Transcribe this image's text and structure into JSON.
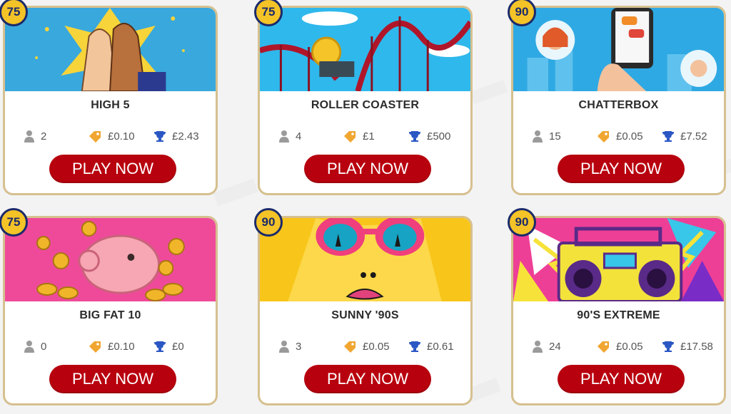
{
  "colors": {
    "ball": "#f3c327",
    "ball_border": "#1b2a6b",
    "button": "#b8010e",
    "card_border": "#d6c08f"
  },
  "cards": [
    {
      "ball": "75",
      "title": "HIGH 5",
      "players": "2",
      "ticket": "£0.10",
      "prize": "£2.43",
      "button": "PLAY NOW",
      "art": "high-five hands"
    },
    {
      "ball": "75",
      "title": "ROLLER COASTER",
      "players": "4",
      "ticket": "£1",
      "prize": "£500",
      "button": "PLAY NOW",
      "art": "roller coaster with coin"
    },
    {
      "ball": "90",
      "title": "CHATTERBOX",
      "players": "15",
      "ticket": "£0.05",
      "prize": "£7.52",
      "button": "PLAY NOW",
      "art": "phone with chat avatars"
    },
    {
      "ball": "75",
      "title": "BIG FAT 10",
      "players": "0",
      "ticket": "£0.10",
      "prize": "£0",
      "button": "PLAY NOW",
      "art": "piggy bank with coins"
    },
    {
      "ball": "90",
      "title": "SUNNY '90S",
      "players": "3",
      "ticket": "£0.05",
      "prize": "£0.61",
      "button": "PLAY NOW",
      "art": "face with pink sunglasses"
    },
    {
      "ball": "90",
      "title": "90'S EXTREME",
      "players": "24",
      "ticket": "£0.05",
      "prize": "£17.58",
      "button": "PLAY NOW",
      "art": "boombox"
    }
  ]
}
